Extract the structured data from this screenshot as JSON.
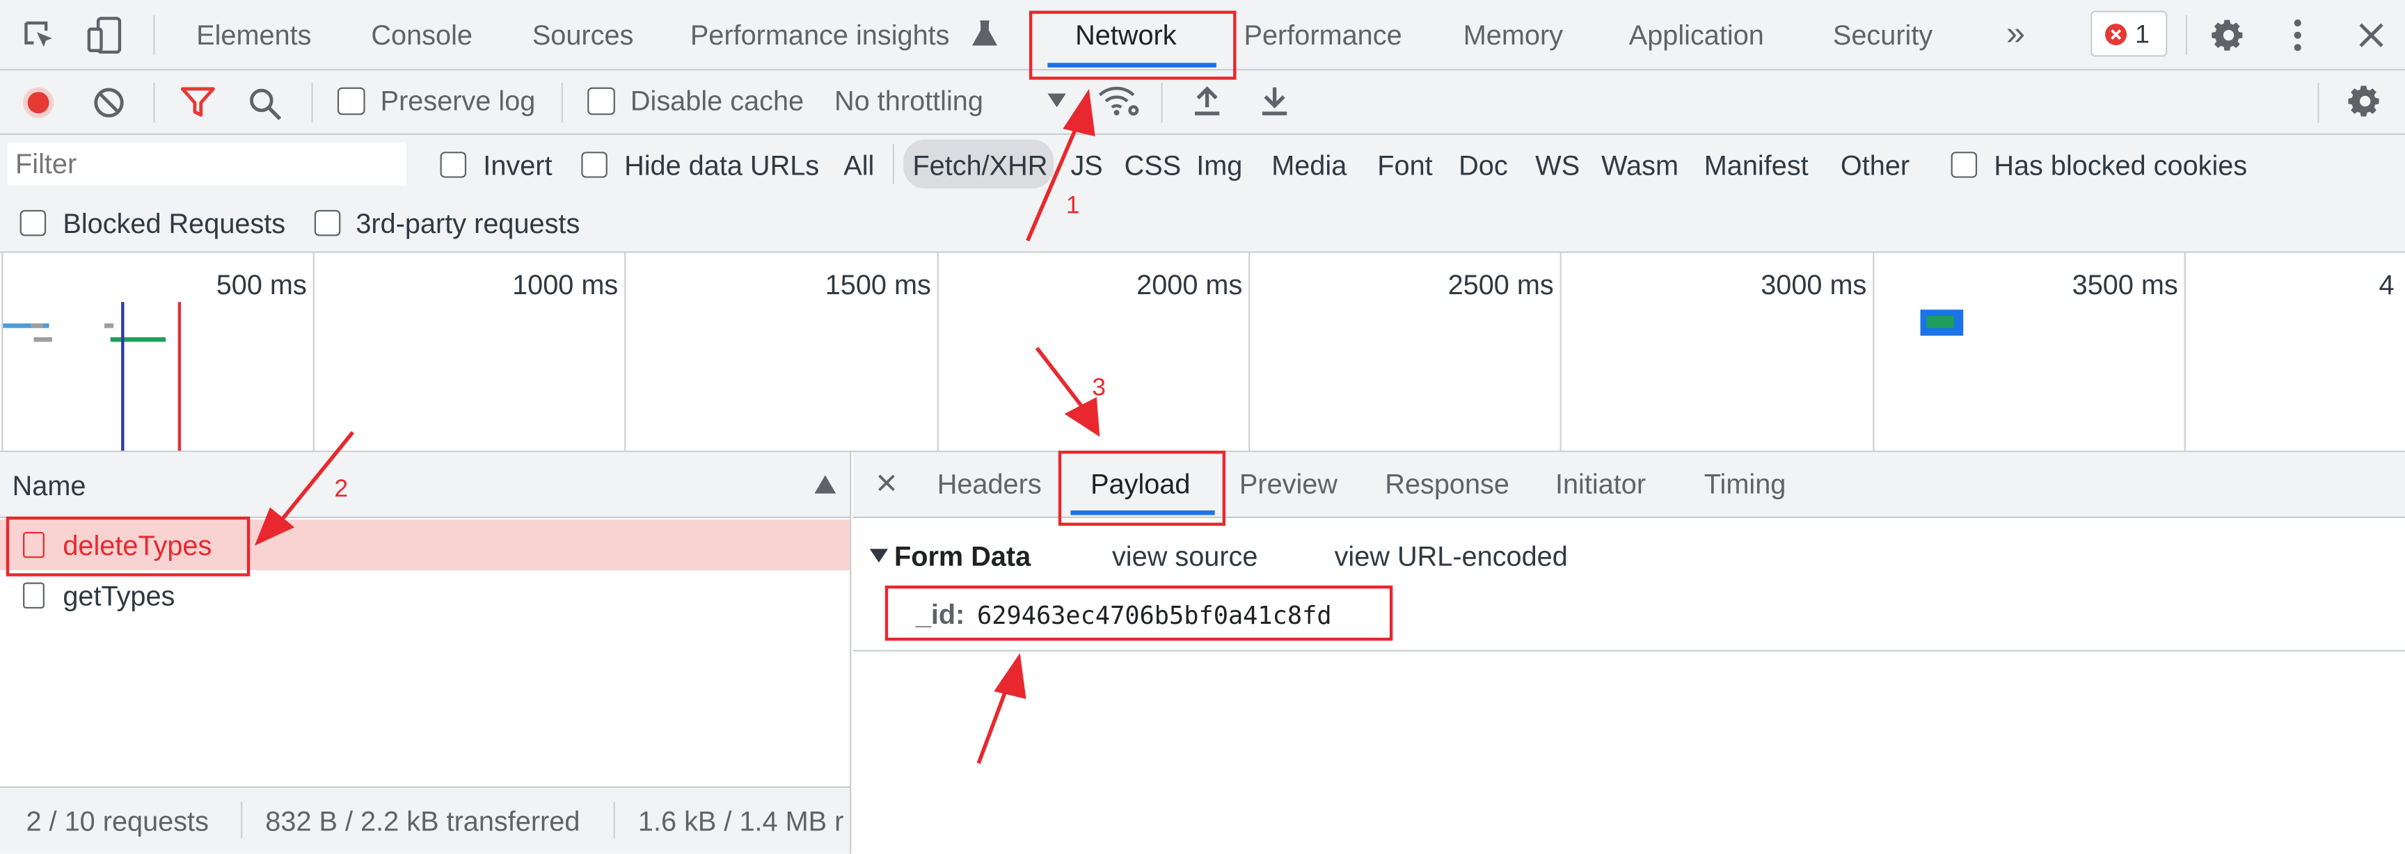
{
  "main_tabs": {
    "elements": "Elements",
    "console": "Console",
    "sources": "Sources",
    "performance_insights": "Performance insights",
    "network": "Network",
    "performance": "Performance",
    "memory": "Memory",
    "application": "Application",
    "security": "Security",
    "more": "»",
    "error_count": "1"
  },
  "toolbar": {
    "preserve_log": "Preserve log",
    "disable_cache": "Disable cache",
    "throttling": "No throttling"
  },
  "filter": {
    "placeholder": "Filter",
    "invert": "Invert",
    "hide_data_urls": "Hide data URLs",
    "types": [
      "All",
      "Fetch/XHR",
      "JS",
      "CSS",
      "Img",
      "Media",
      "Font",
      "Doc",
      "WS",
      "Wasm",
      "Manifest",
      "Other"
    ],
    "active_type": "Fetch/XHR",
    "has_blocked_cookies": "Has blocked cookies",
    "blocked_requests": "Blocked Requests",
    "third_party": "3rd-party requests"
  },
  "timeline": {
    "ticks": [
      "500 ms",
      "1000 ms",
      "1500 ms",
      "2000 ms",
      "2500 ms",
      "3000 ms",
      "3500 ms",
      "4"
    ]
  },
  "request_list": {
    "header": "Name",
    "requests": [
      {
        "name": "deleteTypes",
        "selected": true
      },
      {
        "name": "getTypes",
        "selected": false
      }
    ]
  },
  "status_bar": {
    "requests": "2 / 10 requests",
    "transferred": "832 B / 2.2 kB transferred",
    "resources": "1.6 kB / 1.4 MB r"
  },
  "detail_tabs": {
    "close": "×",
    "headers": "Headers",
    "payload": "Payload",
    "preview": "Preview",
    "response": "Response",
    "initiator": "Initiator",
    "timing": "Timing"
  },
  "payload": {
    "section_title": "Form Data",
    "view_source": "view source",
    "view_url_encoded": "view URL-encoded",
    "key": "_id:",
    "value": "629463ec4706b5bf0a41c8fd"
  },
  "annotations": {
    "a1": "1",
    "a2": "2",
    "a3": "3"
  },
  "colors": {
    "annotation_red": "#e8282e",
    "accent_blue": "#1a73e8",
    "record_red": "#e53935",
    "selected_row_bg": "#f9d3d2"
  }
}
